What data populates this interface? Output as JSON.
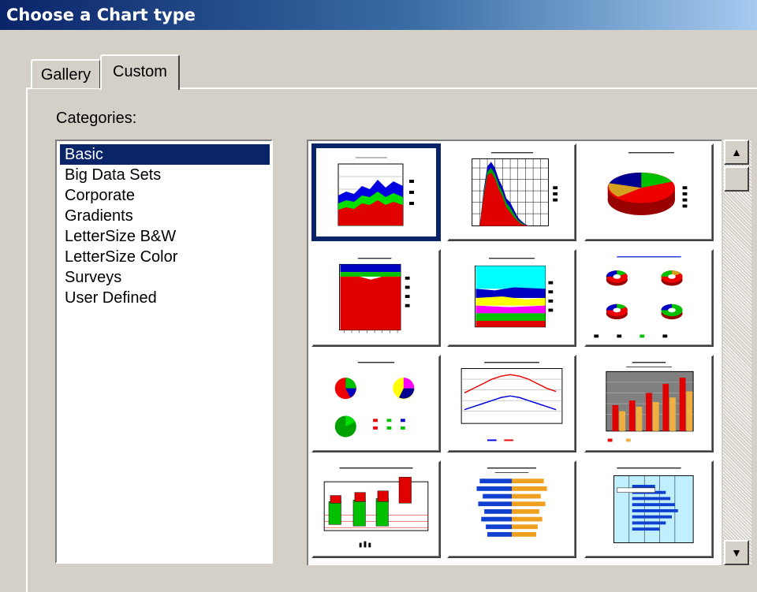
{
  "window": {
    "title": "Choose a Chart type"
  },
  "tabs": [
    {
      "label": "Gallery",
      "active": false
    },
    {
      "label": "Custom",
      "active": true
    }
  ],
  "categories_label": "Categories:",
  "categories": [
    "Basic",
    "Big Data Sets",
    "Corporate",
    "Gradients",
    "LetterSize B&W",
    "LetterSize Color",
    "Surveys",
    "User Defined"
  ],
  "selected_category": "Basic",
  "scrollbar": {
    "up_icon": "arrow-up-icon",
    "down_icon": "arrow-down-icon"
  },
  "colors": {
    "selection": "#0a246a",
    "dialog": "#d4d0c8"
  }
}
